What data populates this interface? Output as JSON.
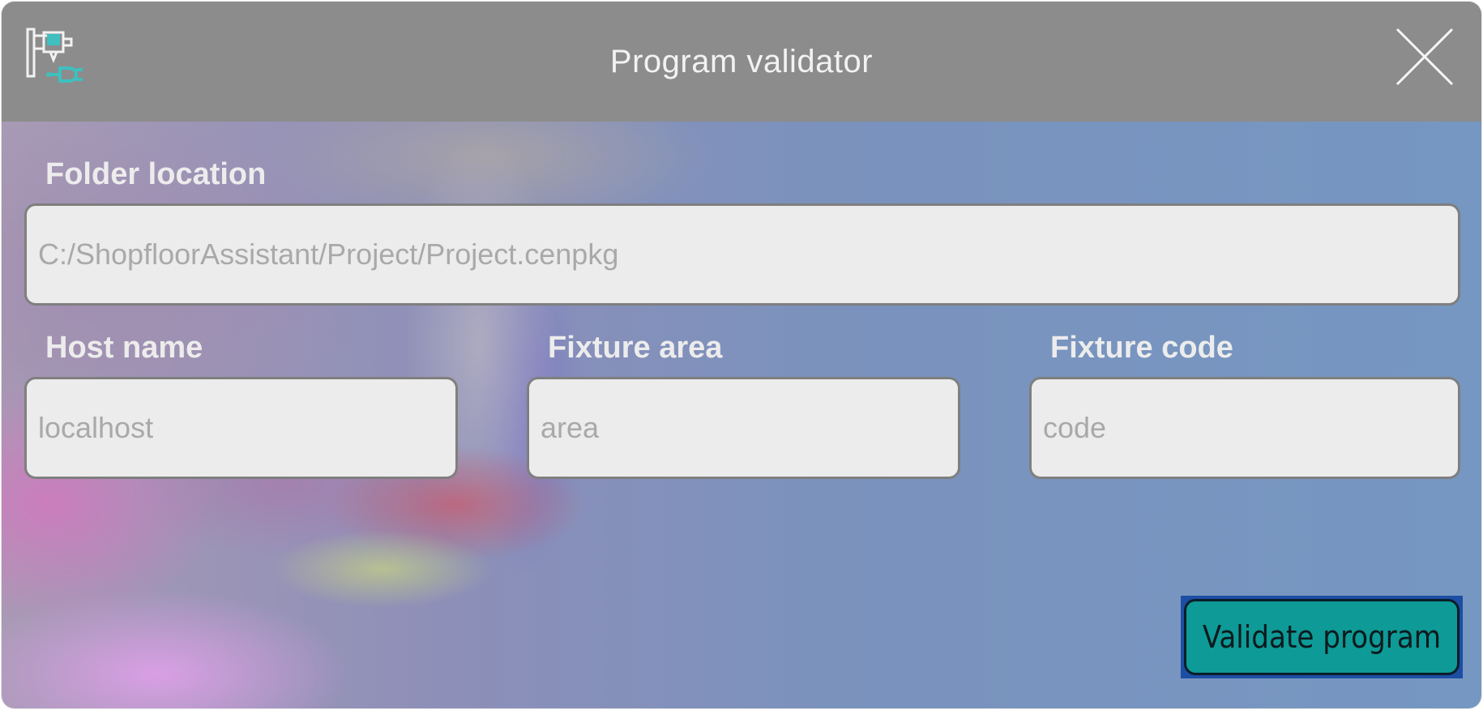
{
  "window": {
    "title": "Program validator"
  },
  "icons": {
    "app": "robot-arm-plug-icon",
    "close": "close-icon"
  },
  "form": {
    "folder_location": {
      "label": "Folder location",
      "placeholder": "C:/ShopfloorAssistant/Project/Project.cenpkg"
    },
    "host_name": {
      "label": "Host name",
      "placeholder": "localhost"
    },
    "fixture_area": {
      "label": "Fixture area",
      "placeholder": "area"
    },
    "fixture_code": {
      "label": "Fixture code",
      "placeholder": "code"
    }
  },
  "actions": {
    "validate_label": "Validate program"
  },
  "colors": {
    "titlebar": "#8c8c8c",
    "field_background": "#ececec",
    "button_fill": "#0e9a96",
    "button_focus_ring": "#1c4ea3",
    "icon_accent": "#3fbfbf"
  }
}
